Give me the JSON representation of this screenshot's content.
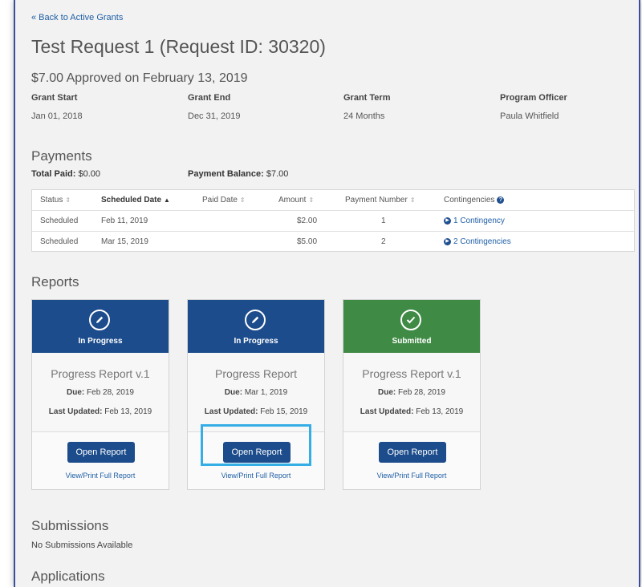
{
  "nav": {
    "back_link": "« Back to Active Grants"
  },
  "header": {
    "title": "Test Request 1 (Request ID: 30320)",
    "approved": "$7.00 Approved on February 13, 2019"
  },
  "grant_meta": [
    {
      "label": "Grant Start",
      "value": "Jan 01, 2018"
    },
    {
      "label": "Grant End",
      "value": "Dec 31, 2019"
    },
    {
      "label": "Grant Term",
      "value": "24 Months"
    },
    {
      "label": "Program Officer",
      "value": "Paula Whitfield"
    }
  ],
  "payments": {
    "title": "Payments",
    "total_paid_label": "Total Paid:",
    "total_paid_value": "$0.00",
    "balance_label": "Payment Balance:",
    "balance_value": "$7.00",
    "columns": [
      "Status",
      "Scheduled Date",
      "Paid Date",
      "Amount",
      "Payment Number",
      "Contingencies"
    ],
    "rows": [
      {
        "status": "Scheduled",
        "scheduled_date": "Feb 11, 2019",
        "paid_date": "",
        "amount": "$2.00",
        "payment_number": "1",
        "contingencies": "1 Contingency"
      },
      {
        "status": "Scheduled",
        "scheduled_date": "Mar 15, 2019",
        "paid_date": "",
        "amount": "$5.00",
        "payment_number": "2",
        "contingencies": "2 Contingencies"
      }
    ]
  },
  "reports": {
    "title": "Reports",
    "cards": [
      {
        "status": "In Progress",
        "status_icon": "pencil-icon",
        "color": "#1c4c8c",
        "name": "Progress Report v.1",
        "due_label": "Due:",
        "due": "Feb 28, 2019",
        "updated_label": "Last Updated:",
        "updated": "Feb 13, 2019",
        "open_label": "Open Report",
        "view_label": "View/Print Full Report"
      },
      {
        "status": "In Progress",
        "status_icon": "pencil-icon",
        "color": "#1c4c8c",
        "name": "Progress Report",
        "due_label": "Due:",
        "due": "Mar 1, 2019",
        "updated_label": "Last Updated:",
        "updated": "Feb 15, 2019",
        "open_label": "Open Report",
        "view_label": "View/Print Full Report"
      },
      {
        "status": "Submitted",
        "status_icon": "checkmark-icon",
        "color": "#3f8a45",
        "name": "Progress Report v.1",
        "due_label": "Due:",
        "due": "Feb 28, 2019",
        "updated_label": "Last Updated:",
        "updated": "Feb 13, 2019",
        "open_label": "Open Report",
        "view_label": "View/Print Full Report"
      }
    ]
  },
  "submissions": {
    "title": "Submissions",
    "empty": "No Submissions Available"
  },
  "applications": {
    "title": "Applications"
  },
  "colors": {
    "link": "#1f5fa6",
    "primary": "#1c4c8c",
    "success": "#3f8a45",
    "highlight": "#35aee6"
  }
}
